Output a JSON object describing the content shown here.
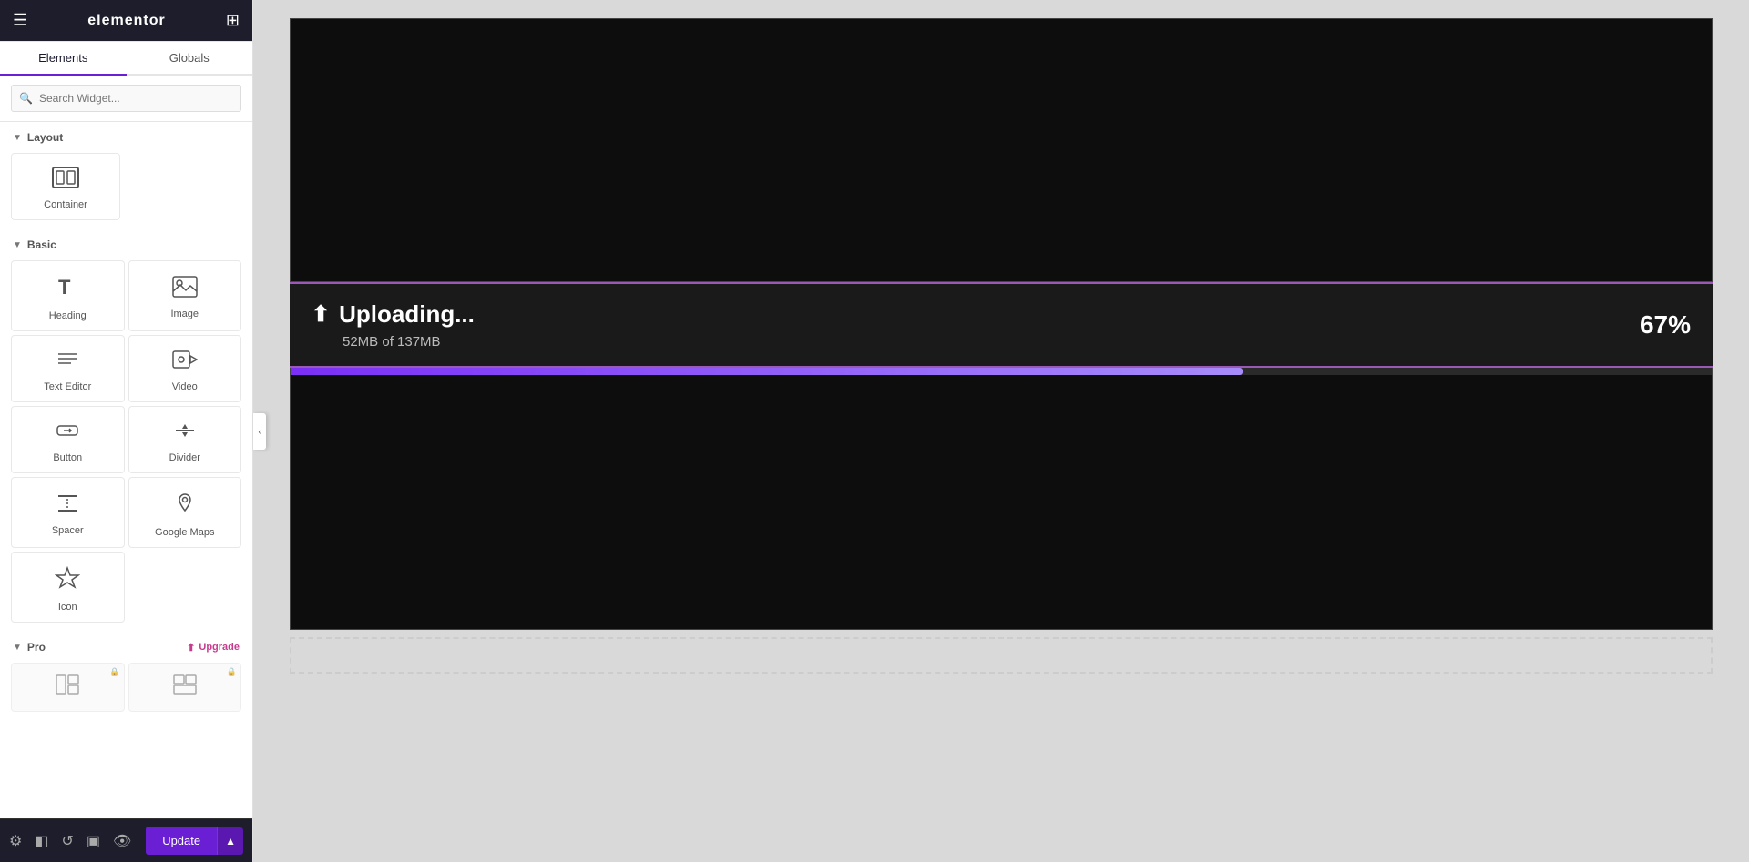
{
  "sidebar": {
    "logo": "elementor",
    "hamburger_label": "☰",
    "grid_label": "⊞",
    "tabs": [
      {
        "id": "elements",
        "label": "Elements",
        "active": true
      },
      {
        "id": "globals",
        "label": "Globals",
        "active": false
      }
    ],
    "search": {
      "placeholder": "Search Widget..."
    },
    "sections": {
      "layout": {
        "label": "Layout",
        "widgets": [
          {
            "id": "container",
            "label": "Container",
            "icon": "container"
          }
        ]
      },
      "basic": {
        "label": "Basic",
        "widgets": [
          {
            "id": "heading",
            "label": "Heading",
            "icon": "heading"
          },
          {
            "id": "image",
            "label": "Image",
            "icon": "image"
          },
          {
            "id": "text-editor",
            "label": "Text Editor",
            "icon": "text-editor"
          },
          {
            "id": "video",
            "label": "Video",
            "icon": "video"
          },
          {
            "id": "button",
            "label": "Button",
            "icon": "button"
          },
          {
            "id": "divider",
            "label": "Divider",
            "icon": "divider"
          },
          {
            "id": "spacer",
            "label": "Spacer",
            "icon": "spacer"
          },
          {
            "id": "google-maps",
            "label": "Google Maps",
            "icon": "google-maps"
          },
          {
            "id": "icon",
            "label": "Icon",
            "icon": "icon"
          }
        ]
      },
      "pro": {
        "label": "Pro",
        "upgrade_label": "Upgrade",
        "widgets": [
          {
            "id": "pro-widget-1",
            "label": "",
            "icon": "pro1"
          },
          {
            "id": "pro-widget-2",
            "label": "",
            "icon": "pro2"
          }
        ]
      }
    }
  },
  "bottom_toolbar": {
    "tools": [
      "settings",
      "layers",
      "history",
      "responsive",
      "eye"
    ],
    "update_button": "Update",
    "update_arrow": "▲"
  },
  "canvas": {
    "upload": {
      "title": "Uploading...",
      "subtitle": "52MB of 137MB",
      "percent": "67%",
      "progress": 67,
      "icon": "⬆"
    }
  }
}
